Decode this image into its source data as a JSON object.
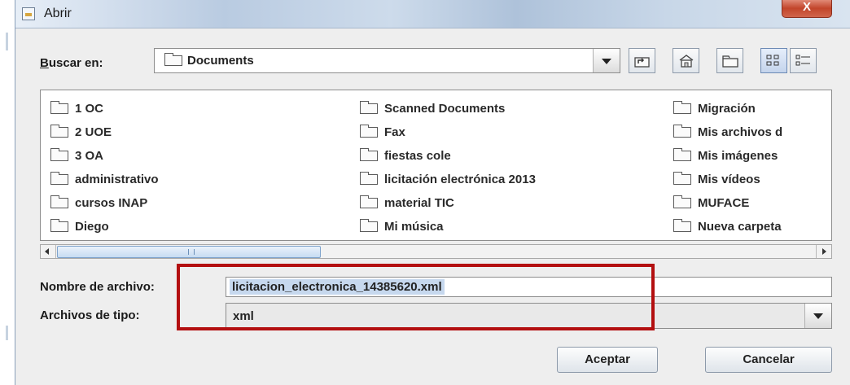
{
  "window": {
    "title": "Abrir",
    "close_glyph": "X",
    "title_icon": "java-file-dialog-icon"
  },
  "lookin": {
    "label_prefix": "B",
    "label_rest": "uscar en:",
    "value": "Documents",
    "folder_icon": "folder-icon"
  },
  "toolbar": {
    "buttons": [
      "up-one-level-icon",
      "home-icon",
      "new-folder-icon",
      "list-view-icon",
      "details-view-icon"
    ],
    "active": "list-view-icon"
  },
  "files": {
    "columns": [
      [
        "1 OC",
        "2 UOE",
        "3 OA",
        "administrativo",
        "cursos INAP",
        "Diego"
      ],
      [
        "Scanned Documents",
        "Fax",
        "fiestas cole",
        "licitación electrónica 2013",
        "material TIC",
        "Mi música"
      ],
      [
        "Migración",
        "Mis archivos d",
        "Mis imágenes",
        "Mis vídeos",
        "MUFACE",
        "Nueva carpeta"
      ]
    ]
  },
  "filename": {
    "label": "Nombre de archivo:",
    "value": "licitacion_electronica_14385620.xml"
  },
  "filetype": {
    "label": "Archivos de tipo:",
    "value": "xml"
  },
  "buttons": {
    "accept": "Aceptar",
    "cancel": "Cancelar"
  },
  "colors": {
    "highlight": "#b30f10",
    "dialog_bg": "#eeeeee",
    "selection": "#c6d8ee"
  }
}
